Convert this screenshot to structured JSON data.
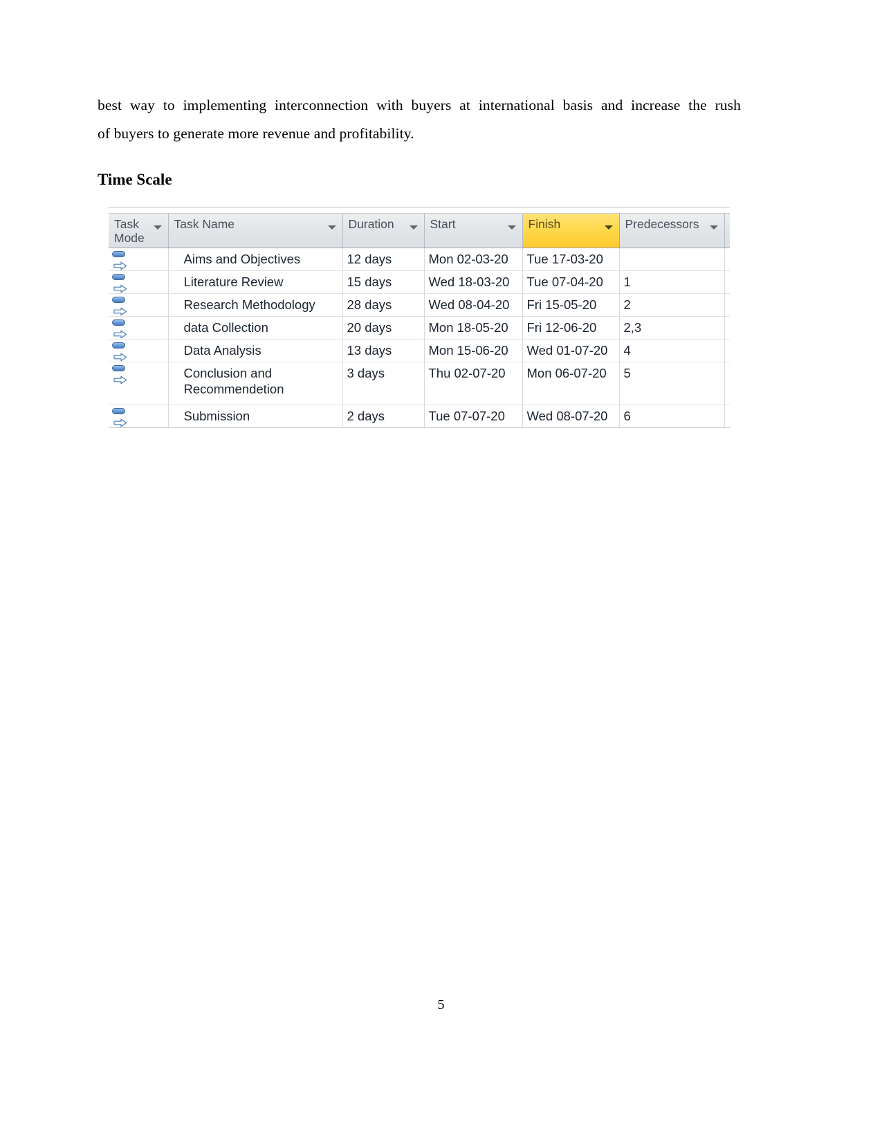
{
  "document": {
    "paragraph_line_1": "best way to implementing interconnection with buyers at international basis and increase the rush",
    "paragraph_line_2": "of buyers to generate more revenue and profitability.",
    "heading": "Time Scale",
    "page_number": "5"
  },
  "grid": {
    "headers": {
      "task_mode": "Task Mode",
      "task_name": "Task Name",
      "duration": "Duration",
      "start": "Start",
      "finish": "Finish",
      "predecessors": "Predecessors"
    },
    "highlighted_column": "Finish",
    "highlight_color": "#ffd84a",
    "header_background": "#e2e5e8",
    "header_text_color": "#46505a",
    "filter_icon": "chevron-down-icon",
    "task_mode_icon": "auto-schedule-icon",
    "rows": [
      {
        "task_mode": "auto-schedule-icon",
        "task_name": "Aims and Objectives",
        "duration": "12 days",
        "start": "Mon 02-03-20",
        "finish": "Tue 17-03-20",
        "predecessors": ""
      },
      {
        "task_mode": "auto-schedule-icon",
        "task_name": "Literature Review",
        "duration": "15 days",
        "start": "Wed 18-03-20",
        "finish": "Tue 07-04-20",
        "predecessors": "1"
      },
      {
        "task_mode": "auto-schedule-icon",
        "task_name": "Research Methodology",
        "duration": "28 days",
        "start": "Wed 08-04-20",
        "finish": "Fri 15-05-20",
        "predecessors": "2"
      },
      {
        "task_mode": "auto-schedule-icon",
        "task_name": "data Collection",
        "duration": "20 days",
        "start": "Mon 18-05-20",
        "finish": "Fri 12-06-20",
        "predecessors": "2,3"
      },
      {
        "task_mode": "auto-schedule-icon",
        "task_name": "Data Analysis",
        "duration": "13 days",
        "start": "Mon 15-06-20",
        "finish": "Wed 01-07-20",
        "predecessors": "4"
      },
      {
        "task_mode": "auto-schedule-icon",
        "task_name": "Conclusion and Recommendetion",
        "duration": "3 days",
        "start": "Thu 02-07-20",
        "finish": "Mon 06-07-20",
        "predecessors": "5"
      },
      {
        "task_mode": "auto-schedule-icon",
        "task_name": "Submission",
        "duration": "2 days",
        "start": "Tue 07-07-20",
        "finish": "Wed 08-07-20",
        "predecessors": "6"
      }
    ]
  }
}
